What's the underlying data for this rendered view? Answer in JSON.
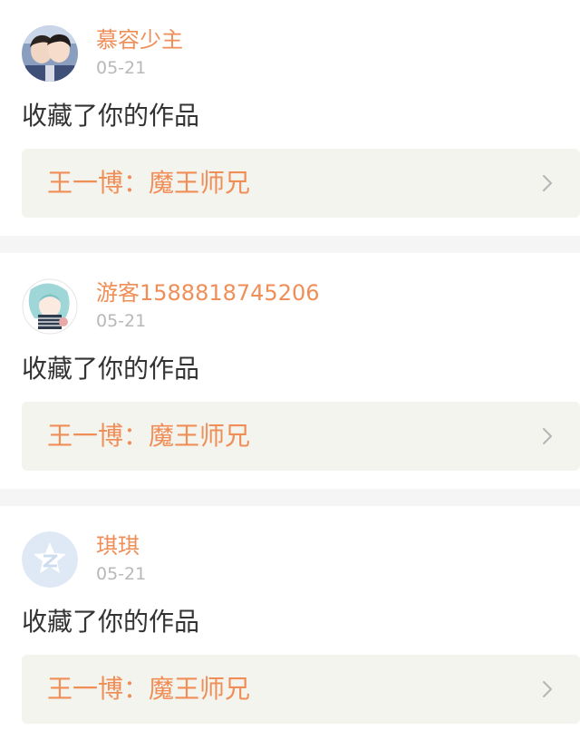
{
  "feed": {
    "items": [
      {
        "username": "慕容少主",
        "date": "05-21",
        "action": "收藏了你的作品",
        "work_title": "王一博：魔王师兄",
        "avatar_icon": "two-people-photo-avatar",
        "chevron_icon": "chevron-right-icon"
      },
      {
        "username": "游客1588818745206",
        "date": "05-21",
        "action": "收藏了你的作品",
        "work_title": "王一博：魔王师兄",
        "avatar_icon": "anime-character-avatar",
        "chevron_icon": "chevron-right-icon"
      },
      {
        "username": "琪琪",
        "date": "05-21",
        "action": "收藏了你的作品",
        "work_title": "王一博：魔王师兄",
        "avatar_icon": "default-qzone-avatar",
        "chevron_icon": "chevron-right-icon"
      }
    ]
  },
  "colors": {
    "accent": "#f08e58",
    "date": "#b8b8b8",
    "text": "#333333",
    "link_bg": "#f4f4ee",
    "separator": "#f5f5f5"
  }
}
